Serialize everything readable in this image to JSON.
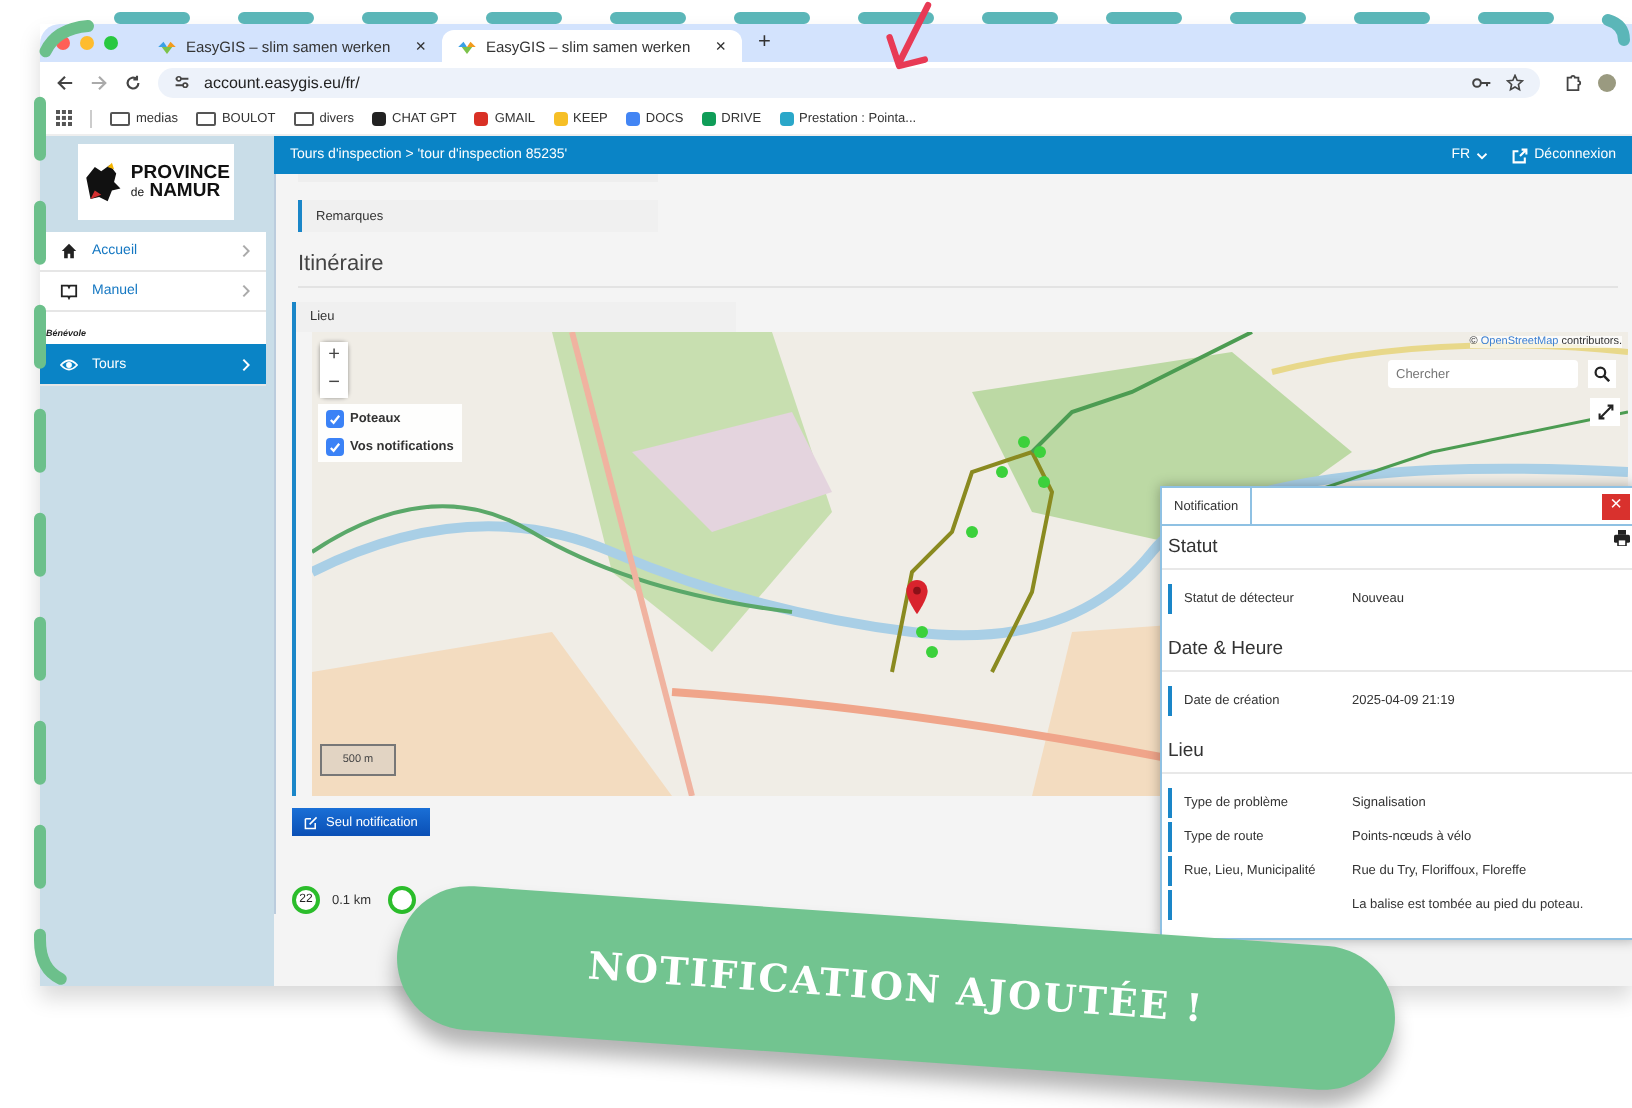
{
  "browser": {
    "tabs": [
      {
        "title": "EasyGIS – slim samen werken",
        "close": "×",
        "selected": false
      },
      {
        "title": "EasyGIS – slim samen werken",
        "close": "×",
        "selected": true
      }
    ],
    "new_tab": "+",
    "address": "account.easygis.eu/fr/",
    "bookmarks": [
      {
        "label": "medias",
        "kind": "folder"
      },
      {
        "label": "BOULOT",
        "kind": "folder"
      },
      {
        "label": "divers",
        "kind": "folder"
      },
      {
        "label": "CHAT GPT",
        "kind": "site",
        "color": "#222222"
      },
      {
        "label": "GMAIL",
        "kind": "site",
        "color": "#d93025"
      },
      {
        "label": "KEEP",
        "kind": "site",
        "color": "#f6bf26"
      },
      {
        "label": "DOCS",
        "kind": "site",
        "color": "#4285f4"
      },
      {
        "label": "DRIVE",
        "kind": "site",
        "color": "#0f9d58"
      },
      {
        "label": "Prestation : Pointa...",
        "kind": "site",
        "color": "#2aa7c9"
      }
    ]
  },
  "sidebar": {
    "logo": {
      "line1": "PROVINCE",
      "line2a": "de",
      "line2b": "NAMUR"
    },
    "items": [
      {
        "label": "Accueil",
        "selected": false
      },
      {
        "label": "Manuel",
        "selected": false
      }
    ],
    "section": "Bénévole",
    "section_items": [
      {
        "label": "Tours",
        "selected": true
      }
    ]
  },
  "header": {
    "breadcrumb": "Tours d'inspection > 'tour d'inspection 85235'",
    "language": "FR",
    "logout": "Déconnexion"
  },
  "content": {
    "remarks_label": "Remarques",
    "itinerary_heading": "Itinéraire",
    "place_label": "Lieu",
    "map": {
      "layers": [
        {
          "label": "Poteaux",
          "checked": true
        },
        {
          "label": "Vos notifications",
          "checked": true
        }
      ],
      "zoom_in": "+",
      "zoom_out": "−",
      "search_placeholder": "Chercher",
      "attribution_prefix": "©",
      "attribution_link": "OpenStreetMap",
      "attribution_suffix": "contributors.",
      "scale": "500 m"
    },
    "button": "Seul notification",
    "route": [
      {
        "node": "22",
        "distance": "0.1 km"
      }
    ]
  },
  "notification": {
    "tab": "Notification",
    "close": "×",
    "sections": [
      {
        "title": "Statut",
        "rows": [
          {
            "label": "Statut de détecteur",
            "value": "Nouveau"
          }
        ]
      },
      {
        "title": "Date & Heure",
        "rows": [
          {
            "label": "Date de création",
            "value": "2025-04-09 21:19"
          }
        ]
      },
      {
        "title": "Lieu",
        "rows": [
          {
            "label": "Type de problème",
            "value": "Signalisation"
          },
          {
            "label": "Type de route",
            "value": "Points-nœuds à vélo"
          },
          {
            "label": "Rue, Lieu, Municipalité",
            "value": "Rue du Try, Floriffoux, Floreffe"
          },
          {
            "value": "La balise est tombée au pied du poteau."
          }
        ]
      }
    ]
  },
  "banner": "NOTIFICATION AJOUTÉE !"
}
